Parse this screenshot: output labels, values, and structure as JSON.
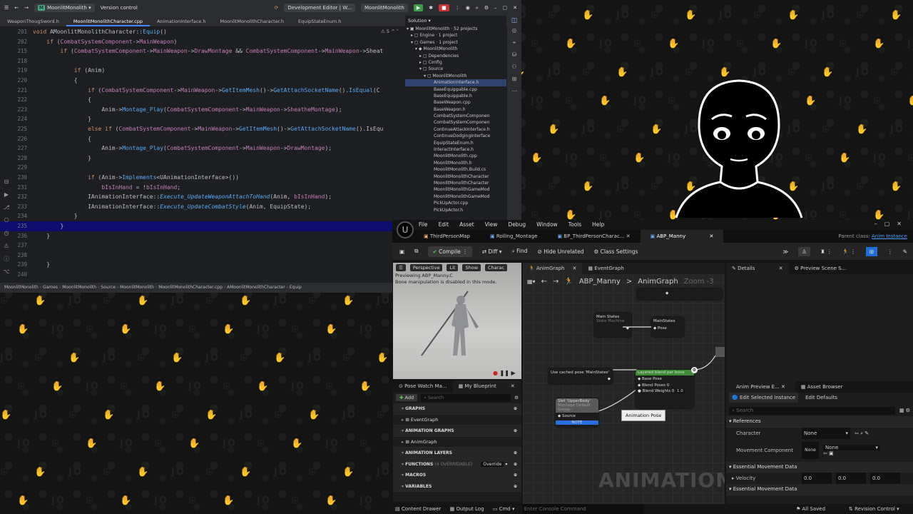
{
  "ide": {
    "topbar": {
      "project": "MoonlitMonolith",
      "vcs": "Version control",
      "config": "Development Editor | W...",
      "target": "MoonlitMonolith"
    },
    "tabs": [
      "WeaponThougSword.h",
      "MoonlitMonolithCharacter.cpp",
      "AnimationInterface.h",
      "MoonlitMonolithCharacter.h",
      "EquipStateEnum.h"
    ],
    "editor_hint": "⚠ 5 ^ ˅",
    "lines": [
      {
        "n": "201",
        "t": "void AMoonlitMonolithCharacter::Equip()"
      },
      {
        "n": "202",
        "t": "    if (CombatSystemComponent->MainWeapon)"
      },
      {
        "n": "215",
        "t": "        if (CombatSystemComponent->MainWeapon->DrawMontage && CombatSystemComponent->MainWeapon->Sheat"
      },
      {
        "n": "218",
        "t": ""
      },
      {
        "n": "219",
        "t": "            if (Anim)"
      },
      {
        "n": "220",
        "t": "            {"
      },
      {
        "n": "221",
        "t": "                if (CombatSystemComponent->MainWeapon->GetItemMesh()->GetAttachSocketName().IsEqual(C"
      },
      {
        "n": "222",
        "t": "                {"
      },
      {
        "n": "223",
        "t": "                    Anim->Montage_Play(CombatSystemComponent->MainWeapon->SheatheMontage);"
      },
      {
        "n": "224",
        "t": "                }"
      },
      {
        "n": "225",
        "t": "                else if (CombatSystemComponent->MainWeapon->GetItemMesh()->GetAttachSocketName().IsEqu"
      },
      {
        "n": "226",
        "t": "                {"
      },
      {
        "n": "227",
        "t": "                    Anim->Montage_Play(CombatSystemComponent->MainWeapon->DrawMontage);"
      },
      {
        "n": "228",
        "t": "                }"
      },
      {
        "n": "229",
        "t": ""
      },
      {
        "n": "230",
        "t": "                if (Anim->Implements<UAnimationInterface>())"
      },
      {
        "n": "231",
        "t": "                    bIsInHand = !bIsInHand;"
      },
      {
        "n": "232",
        "t": "                IAnimationInterface::Execute_UpdateWeaponAttachToHand(Anim, bIsInHand);"
      },
      {
        "n": "233",
        "t": "                IAnimationInterface::Execute_UpdateCombatStyle(Anim, EquipState);"
      },
      {
        "n": "234",
        "t": "            }"
      },
      {
        "n": "235",
        "t": "        }"
      },
      {
        "n": "236",
        "t": "    }"
      },
      {
        "n": "237",
        "t": ""
      },
      {
        "n": "238",
        "t": ""
      },
      {
        "n": "239",
        "t": "    }"
      },
      {
        "n": "240",
        "t": ""
      }
    ],
    "solution": {
      "title": "Solution",
      "rows": [
        "▾ ▣ MoonlitMonolith · 52 projects",
        "▸ ▢ Engine · 1 project",
        "▾ ▢ Games · 1 project",
        "▾ ◆ MoonlitMonolith",
        "▸ ▢ Dependencies",
        "▸ ▢ Config",
        "▾ ▢ Source",
        "▾ ▢ MoonlitMonolith",
        "AnimationInterface.h",
        "BaseEquippable.cpp",
        "BaseEquippable.h",
        "BaseWeapon.cpp",
        "BaseWeapon.h",
        "CombatSystemComponen",
        "CombatSystemComponen",
        "ContinueAttackInterface.h",
        "ContinueDodgingInterface",
        "EquipStateEnum.h",
        "InteractInterface.h",
        "MoonlitMonolith.cpp",
        "MoonlitMonolith.h",
        "MoonlitMonolith.Build.cs",
        "MoonlitMonolithCharacter",
        "MoonlitMonolithCharacter",
        "MoonlitMonolithGameMod",
        "MoonlitMonolithGameMod",
        "PickUpActor.cpp",
        "PickUpActor.h"
      ]
    },
    "breadcrumb": [
      "MoonlitMonolith",
      "Games",
      "MoonlitMonolith",
      "Source",
      "MoonlitMonolith",
      "MoonlitMonolithCharacter.cpp",
      "AMoonlitMonolithCharacter",
      "Equip"
    ]
  },
  "ue": {
    "menu": [
      "File",
      "Edit",
      "Asset",
      "View",
      "Debug",
      "Window",
      "Tools",
      "Help"
    ],
    "tabs": [
      "ThirdPersonMap",
      "Rolling_Montage",
      "BP_ThirdPersonCharac...",
      "ABP_Manny"
    ],
    "parent_class_label": "Parent class:",
    "parent_class": "Anim Instance",
    "toolbar": {
      "compile": "Compile",
      "diff": "Diff",
      "find": "Find",
      "hide_unrelated": "Hide Unrelated",
      "class_settings": "Class Settings"
    },
    "viewport": {
      "perspective": "Perspective",
      "lit": "Lit",
      "show": "Show",
      "character": "Charac",
      "overlay1": "Previewing ABP_Manny.C",
      "overlay2": "Bone manipulation is disabled in this mode."
    },
    "graph_tabs": {
      "anim": "AnimGraph",
      "event": "EventGraph"
    },
    "graph_breadcrumb": {
      "root": "ABP_Manny",
      "sep": ">",
      "leaf": "AnimGraph",
      "zoom": "Zoom -3"
    },
    "nodes": {
      "main_states": "Main States",
      "state_machine": "State Machine",
      "main_states2": "MainStates",
      "pose": "Pose",
      "cached": "Use cached pose 'MainStates'",
      "layered": "Layered blend per bone",
      "base_pose": "Base Pose",
      "blend_poses": "Blend Poses 0",
      "blend_weights": "Blend Weights 0",
      "blend_val": "1.0",
      "slot": "Slot 'UpperBody'",
      "slot_sub": "Montage Default Group",
      "source": "Source",
      "tooltip": "Animation Pose",
      "note": "NOTE"
    },
    "watermark": "ANIMATION",
    "mybp": {
      "tab1": "Pose Watch Ma...",
      "tab2": "My Blueprint",
      "add": "Add",
      "search": "Search",
      "sections": [
        {
          "h": "GRAPHS"
        },
        {
          "i": "EventGraph"
        },
        {
          "h": "ANIMATION GRAPHS"
        },
        {
          "i": "AnimGraph"
        },
        {
          "h": "ANIMATION LAYERS"
        },
        {
          "h": "FUNCTIONS",
          "sub": "(4 OVERRIDABLE)",
          "extra": "Override"
        },
        {
          "h": "MACROS"
        },
        {
          "h": "VARIABLES"
        }
      ]
    },
    "details": {
      "tab1": "Details",
      "tab2": "Preview Scene S...",
      "tab3": "Anim Preview E...",
      "tab4": "Asset Browser",
      "btn1": "Edit Selected Instance",
      "btn2": "Edit Defaults",
      "search": "Search",
      "references": "References",
      "character": "Character",
      "none": "None",
      "movement": "Movement Component",
      "essential": "Essential Movement Data",
      "velocity": "Velocity",
      "v0": "0.0",
      "v1": "0.0",
      "v2": "0.0",
      "essential2": "Essential Movement Data"
    },
    "status": {
      "drawer": "Content Drawer",
      "output": "Output Log",
      "cmd": "Cmd",
      "console": "Enter Console Command",
      "saved": "All Saved",
      "rc": "Revision Control"
    }
  },
  "colors": {
    "accent": "#4a88ff",
    "node_green": "#3f8a35",
    "highlight": "#0d0d6e"
  }
}
